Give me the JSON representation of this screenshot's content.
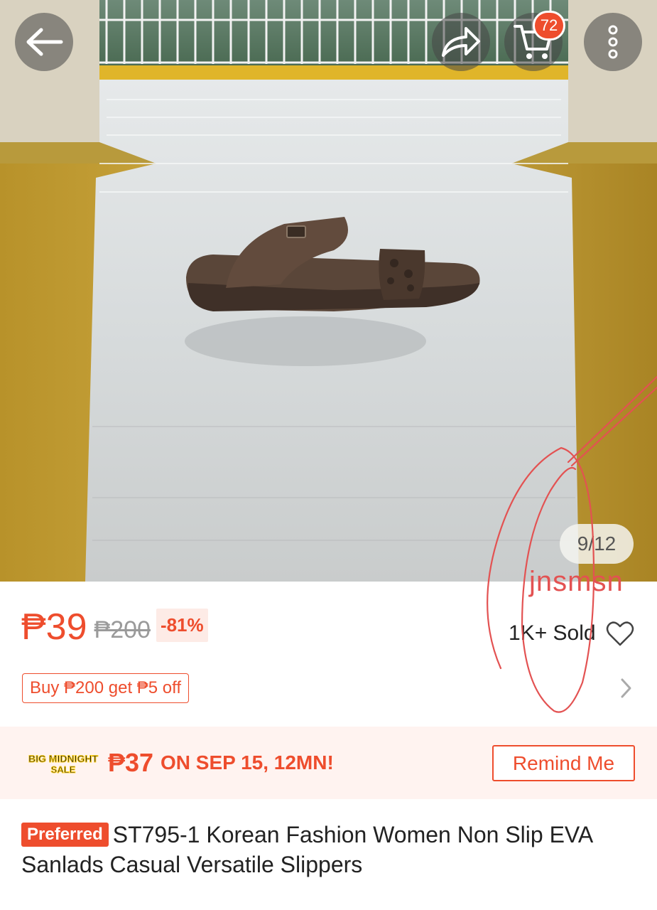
{
  "header": {
    "back_icon": "arrow-left-icon",
    "share_icon": "share-icon",
    "cart_icon": "cart-icon",
    "cart_count": "72",
    "more_icon": "more-vertical-icon"
  },
  "gallery": {
    "counter": "9/12"
  },
  "annotation": {
    "handwritten_text": "jnsmsn",
    "stroke_color": "#e35252"
  },
  "pricing": {
    "price": "₱39",
    "original_price": "₱200",
    "discount": "-81%",
    "sold": "1K+ Sold",
    "voucher": "Buy ₱200 get ₱5 off"
  },
  "flash_sale": {
    "logo_text_1": "BIG MIDNIGHT",
    "logo_text_2": "SALE",
    "price": "₱37",
    "date_text": "ON SEP 15, 12MN!",
    "remind_label": "Remind Me"
  },
  "product": {
    "badge": "Preferred",
    "title": "ST795-1 Korean Fashion Women Non Slip EVA Sanlads Casual Versatile Slippers"
  },
  "colors": {
    "accent": "#ee4d2d",
    "banner_bg": "#fff3f0"
  }
}
